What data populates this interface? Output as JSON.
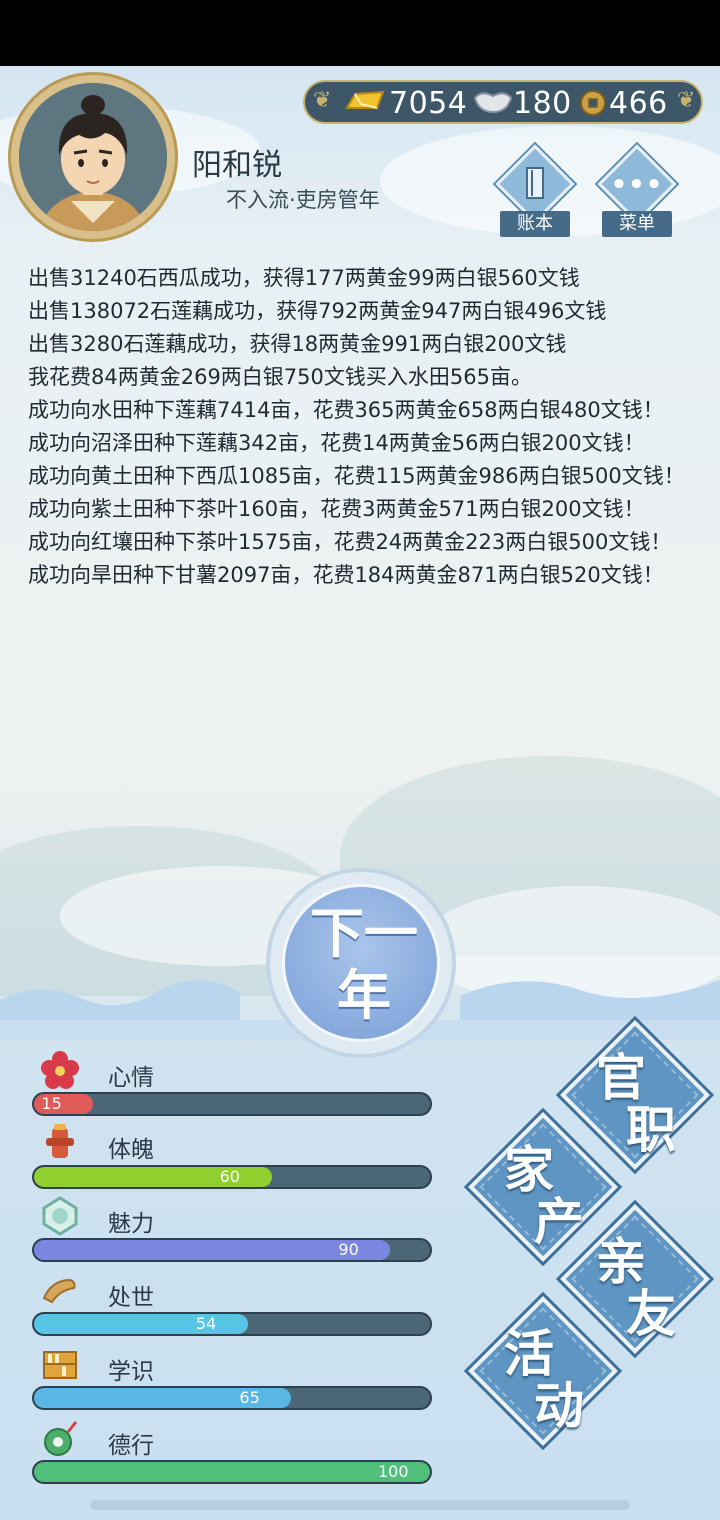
{
  "resources": {
    "gold": "7054",
    "silver": "180",
    "coin": "466"
  },
  "player": {
    "name": "阳和锐",
    "rank": "不入流·吏房管年"
  },
  "header_buttons": {
    "ledger": "账本",
    "menu": "菜单"
  },
  "log": [
    "出售31240石西瓜成功，获得177两黄金99两白银560文钱",
    "出售138072石莲藕成功，获得792两黄金947两白银496文钱",
    "出售3280石莲藕成功，获得18两黄金991两白银200文钱",
    "我花费84两黄金269两白银750文钱买入水田565亩。",
    "成功向水田种下莲藕7414亩，花费365两黄金658两白银480文钱！",
    "成功向沼泽田种下莲藕342亩，花费14两黄金56两白银200文钱！",
    "成功向黄土田种下西瓜1085亩，花费115两黄金986两白银500文钱！",
    "成功向紫土田种下茶叶160亩，花费3两黄金571两白银200文钱！",
    "成功向红壤田种下茶叶1575亩，花费24两黄金223两白银500文钱！",
    "成功向旱田种下甘薯2097亩，花费184两黄金871两白银520文钱！"
  ],
  "next_year": {
    "line1": "下一",
    "line2": "年"
  },
  "stats": [
    {
      "label": "心情",
      "value": "15",
      "level": 0.15,
      "color": "#e05a5a",
      "icon": "flower-icon"
    },
    {
      "label": "体魄",
      "value": "60",
      "level": 0.6,
      "color": "#8fcf2e",
      "icon": "fire-hydrant-icon"
    },
    {
      "label": "魅力",
      "value": "90",
      "level": 0.9,
      "color": "#7b86e0",
      "icon": "gem-icon"
    },
    {
      "label": "处世",
      "value": "54",
      "level": 0.54,
      "color": "#58c5e6",
      "icon": "scroll-icon"
    },
    {
      "label": "学识",
      "value": "65",
      "level": 0.65,
      "color": "#5ab6e4",
      "icon": "bookshelf-icon"
    },
    {
      "label": "德行",
      "value": "100",
      "level": 1.0,
      "color": "#4fbf7a",
      "icon": "jade-pendant-icon"
    }
  ],
  "menu": {
    "office": "官职",
    "family": "家产",
    "relatives": "亲友",
    "events": "活动"
  }
}
